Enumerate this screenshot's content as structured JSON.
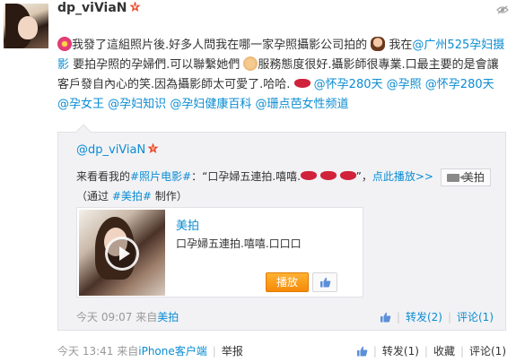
{
  "post": {
    "username": "dp_viViaN",
    "segments": [
      {
        "t": "我發了這組照片後.好多人問我在哪一家孕照攝影公司拍的 "
      },
      {
        "t": "我在"
      },
      {
        "link": "@广州525孕妇摄影"
      },
      {
        "t": " 要拍孕照的孕婦們.可以聯繫她們 "
      },
      {
        "t": "服務態度很好.攝影師很專業.口最主要的是會讓客戶發自內心的笑.因為攝影師太可愛了.哈哈. "
      },
      {
        "link": "@怀孕280天"
      },
      {
        "t": " "
      },
      {
        "link": "@孕照"
      },
      {
        "t": " "
      },
      {
        "link": "@怀孕280天"
      },
      {
        "t": " "
      },
      {
        "link": "@孕女王"
      },
      {
        "t": " "
      },
      {
        "link": "@孕妇知识"
      },
      {
        "t": " "
      },
      {
        "link": "@孕妇健康百科"
      },
      {
        "t": " "
      },
      {
        "link": "@珊点芭女性频道"
      }
    ],
    "time": "今天 13:41",
    "source_prefix": "来自",
    "source": "iPhone客户端",
    "report": "举报",
    "forward": "转发(1)",
    "favorite": "收藏",
    "comment": "评论(1)"
  },
  "repost": {
    "username": "@dp_viViaN",
    "line1_prefix": "来看看我的",
    "line1_tag": "#照片电影#",
    "line1_mid": "：“口孕婦五連拍.嘻嘻.",
    "line1_end": "”，",
    "line1_link": "点此播放>>",
    "meipai_chip": "美拍",
    "line2_open": "（通过 ",
    "line2_tag": "#美拍#",
    "line2_close": " 制作）",
    "video": {
      "title": "美拍",
      "desc": "口孕婦五連拍.嘻嘻.口口口",
      "play": "播放"
    },
    "time": "今天 09:07",
    "source_prefix": "来自",
    "source": "美拍",
    "forward": "转发(2)",
    "comment": "评论(1)"
  },
  "colors": {
    "link": "#0a8cd2",
    "meta": "#999999",
    "accent_orange": "#f58a07",
    "badge": "#e8502f"
  }
}
